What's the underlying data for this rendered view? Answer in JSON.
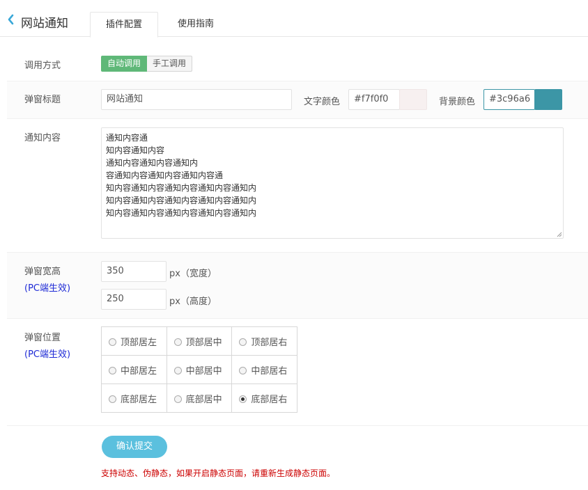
{
  "header": {
    "back_icon": "chevron-left-icon",
    "title": "网站通知",
    "tabs": [
      {
        "label": "插件配置",
        "active": true
      },
      {
        "label": "使用指南",
        "active": false
      }
    ]
  },
  "call_mode": {
    "label": "调用方式",
    "options": [
      "自动调用",
      "手工调用"
    ],
    "selected": "自动调用"
  },
  "popup_title": {
    "label": "弹窗标题",
    "value": "网站通知",
    "text_color_label": "文字颜色",
    "text_color": "#f7f0f0",
    "bg_color_label": "背景颜色",
    "bg_color": "#3c96a6"
  },
  "content": {
    "label": "通知内容",
    "lines": [
      "通知内容通",
      "知内容通知内容",
      "通知内容通知内容通知内",
      "容通知内容通知内容通知内容通",
      "知内容通知内容通知内容通知内容通知内",
      "知内容通知内容通知内容通知内容通知内",
      "知内容通知内容通知内容通知内容通知内"
    ]
  },
  "size": {
    "label": "弹窗宽高",
    "note": "(PC端生效)",
    "width": "350",
    "width_unit": "px（宽度）",
    "height": "250",
    "height_unit": "px（高度）"
  },
  "position": {
    "label": "弹窗位置",
    "note": "(PC端生效)",
    "options": [
      [
        "顶部居左",
        "顶部居中",
        "顶部居右"
      ],
      [
        "中部居左",
        "中部居中",
        "中部居右"
      ],
      [
        "底部居左",
        "底部居中",
        "底部居右"
      ]
    ],
    "selected": "底部居右"
  },
  "submit_label": "确认提交",
  "footer_note": "支持动态、伪静态，如果开启静态页面，请重新生成静态页面。",
  "colors": {
    "accent_green": "#5fb878",
    "submit_blue": "#5bc0de",
    "note_red": "#cc0000",
    "note_blue": "#1e2ad6"
  }
}
